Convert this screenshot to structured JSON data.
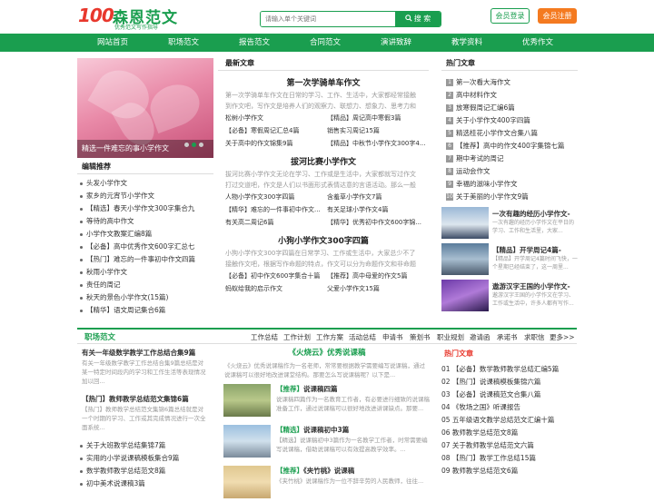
{
  "header": {
    "logo_number": "100",
    "logo_name": "森恩范文",
    "logo_slogan": "优秀范文写作指导",
    "search_placeholder": "请输入单个关键词",
    "search_button": "搜 索",
    "login": "会员登录",
    "register": "会员注册"
  },
  "nav": [
    "网站首页",
    "职场范文",
    "报告范文",
    "合同范文",
    "演讲致辞",
    "教学资料",
    "优秀作文"
  ],
  "slide": {
    "caption": "精选一件难忘的事小学作文"
  },
  "editor_picks": {
    "title": "编辑推荐",
    "items": [
      "头发小学作文",
      "家乡的元宵节小学作文",
      "【精选】春天小学作文300字集合九",
      "等待的高中作文",
      "小学作文教案汇编8篇",
      "【必备】高中优秀作文600字汇总七",
      "【热门】难忘的一件事初中作文四篇",
      "秋雨小学作文",
      "责任的周记",
      "秋天的景色小学作文(15篇)",
      "【精华】语文周记集合6篇"
    ]
  },
  "latest": {
    "title": "最新文章",
    "articles": [
      {
        "h": "第一次学骑单车作文",
        "p": "第一次学骑单车作文在日常的学习、工作、生活中，大家都经常接触到作文吧，写作文是培养人们的观察力、联想力、想象力、思考力和记忆...",
        "rows": [
          [
            "松树小学作文",
            "【精品】周记高中寒假3篇"
          ],
          [
            "【必备】寒假周记汇总4篇",
            "销售实习周记15篇"
          ],
          [
            "关于高中的作文锦集9篇",
            "【精品】中秋节小学作文300字4..."
          ]
        ]
      },
      {
        "h": "拔河比赛小学作文",
        "p": "拔河比赛小学作文无论在学习、工作或是生活中，大家都就写过作文打过交道吧，作文是人们以书面形式表情达意的言语活动。那么一般作文是怎...",
        "rows": [
          [
            "人物小学作文300字四篇",
            "含羞草小学作文7篇"
          ],
          [
            "【精华】难忘的一件事初中作文...",
            "有关足球小学作文4篇"
          ],
          [
            "有关高二周记6篇",
            "【精华】优秀初中作文600字锦..."
          ]
        ]
      },
      {
        "h": "小狗小学作文300字四篇",
        "p": "小狗小学作文300字四篇在日常学习、工作或生活中，大家总少不了接触作文吧，根据写作命题的特点，作文可以分为命题作文和非命题作文。...",
        "rows": [
          [
            "【必备】初中作文600字集合十篇",
            "【推荐】高中母爱的作文5篇"
          ],
          [
            "蚂蚁给我的启示作文",
            "父爱小学作文15篇"
          ]
        ]
      }
    ]
  },
  "hot": {
    "title": "热门文章",
    "items": [
      "第一次看大海作文",
      "高中材料作文",
      "放寒假周记汇编6篇",
      "关于小学作文400字四篇",
      "精选桂花小学作文合集八篇",
      "【推荐】高中的作文400字集锦七篇",
      "期中考试的周记",
      "运动会作文",
      "幸福的滋味小学作文",
      "关于美丽的小学作文9篇"
    ],
    "thumbs": [
      {
        "t": "一次有趣的经历小学作文-",
        "d": "一次有趣的经历小学作文在平日的学习、工作和生活里，大家..."
      },
      {
        "t": "【精品】开学周记4篇-",
        "d": "【精品】开学周记4篇时间飞快，一个星期已经结束了，这一周里..."
      },
      {
        "t": "遨游汉字王国的小学作文-",
        "d": "遨游汉字王国的小学作文在学习、工作或生活中，许多人都有写作..."
      }
    ]
  },
  "career": {
    "label": "职场范文",
    "links": [
      "工作总结",
      "工作计划",
      "工作方案",
      "活动总结",
      "申请书",
      "策划书",
      "职业规划",
      "邀请函",
      "承诺书",
      "求职信",
      "更多>>"
    ]
  },
  "bottom_left": [
    {
      "h": "有关一年级数学教学工作总结合集9篇",
      "p": "有关一年级数学教学工作总结合集9篇总结是对某一特定时间段内的学习和工作生活等表现情况加以回..."
    },
    {
      "h": "【热门】教师教学总结范文集锦6篇",
      "p": "【热门】教师教学总结范文集锦6篇总结就是对一个时期的学习、工作或其完成情况进行一次全面系统..."
    }
  ],
  "bottom_left_list": [
    "关于大班教学总结集锦7篇",
    "实用的小学说课稿模板集合9篇",
    "数学教师教学总结范文8篇",
    "初中美术说课稿3篇"
  ],
  "bottom_mid": {
    "h": "《火烧云》优秀说课稿",
    "intro": "《火烧云》优秀说课稿作为一名老师，常常要根据教学需要编写说课稿，通过说课稿可以很好地改进课堂结构。那要怎么写说课稿呢？以下是...",
    "cards": [
      {
        "tag": "【推荐】",
        "t": "说课稿四篇",
        "d": "说课稿四篇作为一名教育工作者，有必要进行细致的说课稿准备工作，通过说课稿可以很好地改进讲课缺点。那要..."
      },
      {
        "tag": "【精选】",
        "t": "说课稿初中3篇",
        "d": "【精选】说课稿初中3篇作为一名教学工作者，时常需要编写说课稿，借助说课稿可以有效提高教学效率。..."
      },
      {
        "tag": "【推荐】",
        "t": "《夹竹桃》说课稿",
        "d": "《夹竹桃》说课稿作为一位不辞辛劳的人民教师，往往..."
      }
    ]
  },
  "bottom_right": {
    "title": "热门文章",
    "items": [
      "01 【必备】数学教师教学总结汇编5篇",
      "02 【热门】说课稿模板集锦六篇",
      "03 【必备】说课稿范文合集八篇",
      "04 《牧场之国》听课报告",
      "05 五年级语文教学总结范文汇编十篇",
      "06 教师教学总结范文8篇",
      "07 关于教师教学总结范文六篇",
      "08 【热门】教学工作总结15篇",
      "09 教师教学总结范文6篇"
    ]
  }
}
